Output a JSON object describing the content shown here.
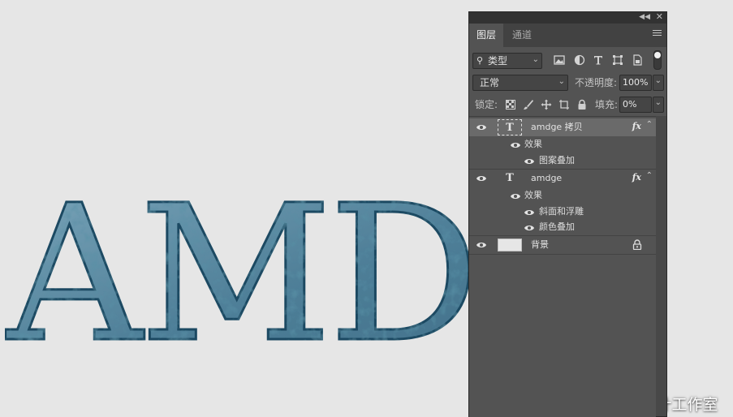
{
  "canvas": {
    "text": "AMDG",
    "fill_color": "#5b8aa2",
    "edge_color": "#1e4a62",
    "background": "#e6e6e6"
  },
  "watermark": "头条号 / 击穿想象设计工作室",
  "panel": {
    "tabs": [
      {
        "label": "图层",
        "active": true
      },
      {
        "label": "通道",
        "active": false
      }
    ],
    "filter": {
      "kind_label": "类型",
      "icons": [
        "image-filter-icon",
        "adjustment-filter-icon",
        "type-filter-icon",
        "shape-filter-icon",
        "smartobject-filter-icon"
      ]
    },
    "blend": {
      "mode": "正常",
      "opacity_label": "不透明度:",
      "opacity": "100%"
    },
    "lock": {
      "label": "锁定:",
      "fill_label": "填充:",
      "fill": "0%"
    },
    "layers": [
      {
        "name": "amdge 拷贝",
        "type": "text",
        "selected": true,
        "effects_label": "效果",
        "effects": [
          "图案叠加"
        ]
      },
      {
        "name": "amdge",
        "type": "text",
        "selected": false,
        "effects_label": "效果",
        "effects": [
          "斜面和浮雕",
          "颜色叠加"
        ]
      },
      {
        "name": "背景",
        "type": "background",
        "selected": false
      }
    ],
    "fx_label": "fx"
  }
}
